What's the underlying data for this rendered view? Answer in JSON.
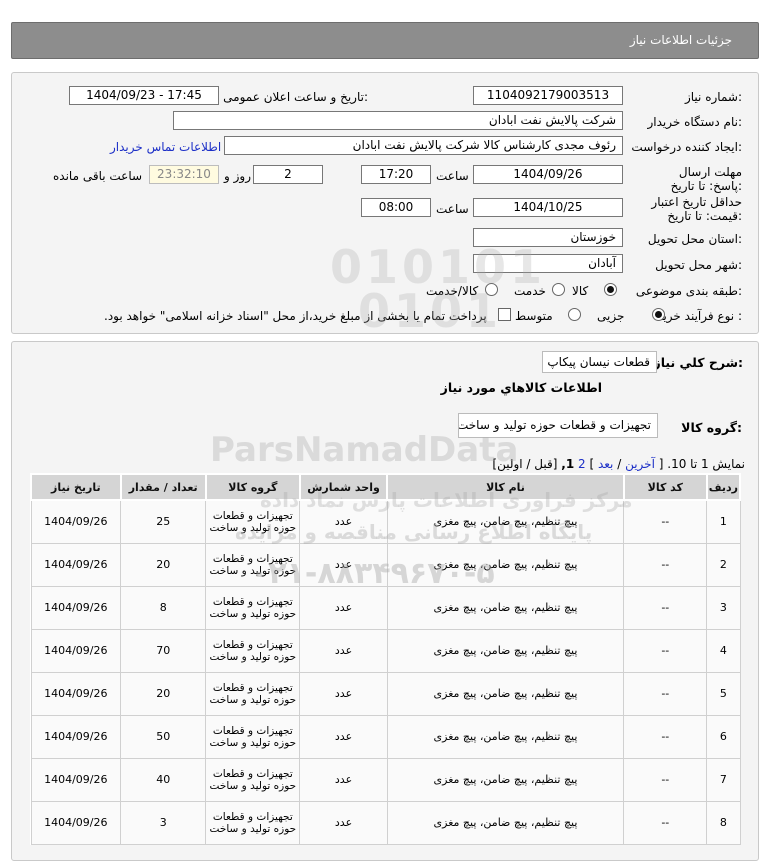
{
  "header": {
    "title": "جزئیات اطلاعات نیاز"
  },
  "details": {
    "need_number_label": "شماره نیاز:",
    "need_number": "1104092179003513",
    "announce_label": "تاریخ و ساعت اعلان عمومی:",
    "announce_value": "1404/09/23 - 17:45",
    "buyer_org_label": "نام دستگاه خریدار:",
    "buyer_org": "شرکت پالایش نفت ابادان",
    "requester_label": "ایجاد کننده درخواست:",
    "requester": "رئوف مجدی کارشناس کالا شرکت پالایش نفت ابادان",
    "contact_link": "اطلاعات تماس خریدار",
    "deadline_label": "مهلت ارسال پاسخ: تا تاریخ:",
    "deadline_date": "1404/09/26",
    "time_label": "ساعت",
    "deadline_time": "17:20",
    "days_value": "2",
    "days_label": "روز و",
    "remaining_time": "23:32:10",
    "remaining_label": "ساعت باقی مانده",
    "validity_label": "حداقل تاریخ اعتبار قیمت: تا تاریخ:",
    "validity_date": "1404/10/25",
    "validity_time": "08:00",
    "province_label": "استان محل تحویل:",
    "province": "خوزستان",
    "city_label": "شهر محل تحویل:",
    "city": "آبادان",
    "category_label": "طبقه بندی موضوعی:",
    "category_options": [
      "کالا",
      "خدمت",
      "کالا/خدمت"
    ],
    "process_label": "نوع فرآیند خرید :",
    "process_options": [
      "جزیی",
      "متوسط"
    ],
    "payment_note": "پرداخت تمام یا بخشی از مبلغ خرید،از محل \"اسناد خزانه اسلامی\" خواهد بود."
  },
  "summary": {
    "desc_label": "شرح کلي نياز:",
    "desc_value": "قطعات نیسان پیکاپ",
    "goods_info_label": "اطلاعات کالاهاي مورد نياز",
    "goods_group_label": "گروه کالا:",
    "goods_group_value": "تجهیزات و قطعات حوزه تولید و ساخت",
    "pager_prefix": "نمایش 1 تا 10.",
    "pager_last": "آخرین",
    "pager_next": "بعد",
    "pager_page2": "2",
    "pager_current": "1,",
    "pager_tail": "[قبل / اولین]"
  },
  "table": {
    "headers": [
      "ردیف",
      "کد کالا",
      "نام کالا",
      "واحد شمارش",
      "گروه کالا",
      "تعداد / مقدار",
      "تاریخ نیاز"
    ],
    "rows": [
      {
        "idx": "1",
        "code": "--",
        "name": "پیچ تنظیم، پیچ ضامن، پیچ مغزی",
        "unit": "عدد",
        "group": "تجهیزات و قطعات حوزه تولید و ساخت",
        "qty": "25",
        "date": "1404/09/26"
      },
      {
        "idx": "2",
        "code": "--",
        "name": "پیچ تنظیم، پیچ ضامن، پیچ مغزی",
        "unit": "عدد",
        "group": "تجهیزات و قطعات حوزه تولید و ساخت",
        "qty": "20",
        "date": "1404/09/26"
      },
      {
        "idx": "3",
        "code": "--",
        "name": "پیچ تنظیم، پیچ ضامن، پیچ مغزی",
        "unit": "عدد",
        "group": "تجهیزات و قطعات حوزه تولید و ساخت",
        "qty": "8",
        "date": "1404/09/26"
      },
      {
        "idx": "4",
        "code": "--",
        "name": "پیچ تنظیم، پیچ ضامن، پیچ مغزی",
        "unit": "عدد",
        "group": "تجهیزات و قطعات حوزه تولید و ساخت",
        "qty": "70",
        "date": "1404/09/26"
      },
      {
        "idx": "5",
        "code": "--",
        "name": "پیچ تنظیم، پیچ ضامن، پیچ مغزی",
        "unit": "عدد",
        "group": "تجهیزات و قطعات حوزه تولید و ساخت",
        "qty": "20",
        "date": "1404/09/26"
      },
      {
        "idx": "6",
        "code": "--",
        "name": "پیچ تنظیم، پیچ ضامن، پیچ مغزی",
        "unit": "عدد",
        "group": "تجهیزات و قطعات حوزه تولید و ساخت",
        "qty": "50",
        "date": "1404/09/26"
      },
      {
        "idx": "7",
        "code": "--",
        "name": "پیچ تنظیم، پیچ ضامن، پیچ مغزی",
        "unit": "عدد",
        "group": "تجهیزات و قطعات حوزه تولید و ساخت",
        "qty": "40",
        "date": "1404/09/26"
      },
      {
        "idx": "8",
        "code": "--",
        "name": "پیچ تنظیم، پیچ ضامن، پیچ مغزی",
        "unit": "عدد",
        "group": "تجهیزات و قطعات حوزه تولید و ساخت",
        "qty": "3",
        "date": "1404/09/26"
      }
    ]
  },
  "watermark": {
    "brand": "ParsNamadData",
    "line1": "مرکز فراوری اطلاعات پارس نماد داده",
    "line2": "پایگاه اطلاع رسانی مناقصه و مزایده",
    "phone": "۰۲۱-۸۸۳۴۹۶۷۰-۵"
  }
}
